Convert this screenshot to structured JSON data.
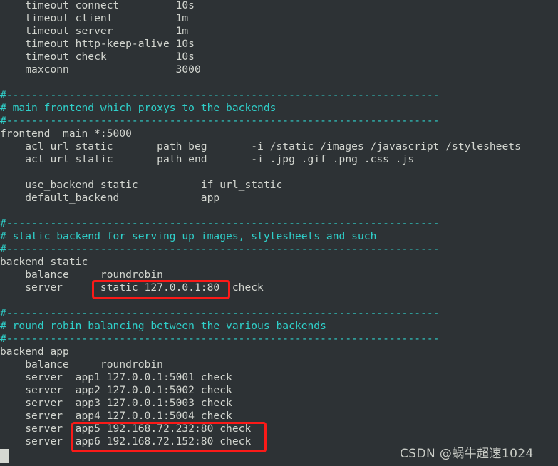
{
  "terminal": {
    "background_color": "#2d3235",
    "text_color": "#d2d5cf",
    "comment_color": "#2fd0ca",
    "highlight_color": "#fb1a18",
    "cursor_color": "#d5d8d2",
    "lines": [
      {
        "text": "    timeout connect         10s",
        "kind": "text"
      },
      {
        "text": "    timeout client          1m",
        "kind": "text"
      },
      {
        "text": "    timeout server          1m",
        "kind": "text"
      },
      {
        "text": "    timeout http-keep-alive 10s",
        "kind": "text"
      },
      {
        "text": "    timeout check           10s",
        "kind": "text"
      },
      {
        "text": "    maxconn                 3000",
        "kind": "text"
      },
      {
        "text": "",
        "kind": "text"
      },
      {
        "text": "#---------------------------------------------------------------------",
        "kind": "comment"
      },
      {
        "text": "# main frontend which proxys to the backends",
        "kind": "comment"
      },
      {
        "text": "#---------------------------------------------------------------------",
        "kind": "comment"
      },
      {
        "text": "frontend  main *:5000",
        "kind": "text"
      },
      {
        "text": "    acl url_static       path_beg       -i /static /images /javascript /stylesheets",
        "kind": "text"
      },
      {
        "text": "    acl url_static       path_end       -i .jpg .gif .png .css .js",
        "kind": "text"
      },
      {
        "text": "",
        "kind": "text"
      },
      {
        "text": "    use_backend static          if url_static",
        "kind": "text"
      },
      {
        "text": "    default_backend             app",
        "kind": "text"
      },
      {
        "text": "",
        "kind": "text"
      },
      {
        "text": "#---------------------------------------------------------------------",
        "kind": "comment"
      },
      {
        "text": "# static backend for serving up images, stylesheets and such",
        "kind": "comment"
      },
      {
        "text": "#---------------------------------------------------------------------",
        "kind": "comment"
      },
      {
        "text": "backend static",
        "kind": "text"
      },
      {
        "text": "    balance     roundrobin",
        "kind": "text"
      },
      {
        "text": "    server      static 127.0.0.1:80  check",
        "kind": "text"
      },
      {
        "text": "",
        "kind": "text"
      },
      {
        "text": "#---------------------------------------------------------------------",
        "kind": "comment"
      },
      {
        "text": "# round robin balancing between the various backends",
        "kind": "comment"
      },
      {
        "text": "#---------------------------------------------------------------------",
        "kind": "comment"
      },
      {
        "text": "backend app",
        "kind": "text"
      },
      {
        "text": "    balance     roundrobin",
        "kind": "text"
      },
      {
        "text": "    server  app1 127.0.0.1:5001 check",
        "kind": "text"
      },
      {
        "text": "    server  app2 127.0.0.1:5002 check",
        "kind": "text"
      },
      {
        "text": "    server  app3 127.0.0.1:5003 check",
        "kind": "text"
      },
      {
        "text": "    server  app4 127.0.0.1:5004 check",
        "kind": "text"
      },
      {
        "text": "    server  app5 192.168.72.232:80 check",
        "kind": "text"
      },
      {
        "text": "    server  app6 192.168.72.152:80 check",
        "kind": "text"
      }
    ]
  },
  "annotations": {
    "highlight_static_server": "static 127.0.0.1:80",
    "highlight_app_servers": "app5 192.168.72.232:80 check / app6 192.168.72.152:80 check"
  },
  "watermark": {
    "text": "CSDN @蜗牛超速1024"
  }
}
